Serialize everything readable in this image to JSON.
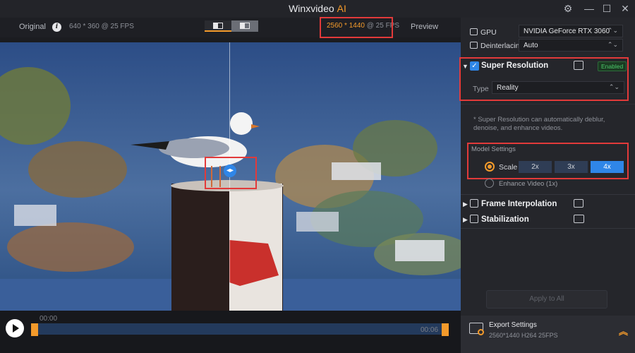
{
  "app": {
    "title": "Winxvideo",
    "title_ai": "AI"
  },
  "compare": {
    "original_label": "Original",
    "original_res": "640 * 360 @ 25 FPS",
    "output_res": "2560 * 1440",
    "output_fps": "@ 25 FPS",
    "preview_label": "Preview"
  },
  "timeline": {
    "start": "00:00",
    "end": "00:06"
  },
  "settings": {
    "gpu_label": "GPU",
    "gpu_value": "NVIDIA GeForce RTX 3060",
    "deinterlacing_label": "Deinterlacing",
    "deinterlacing_value": "Auto",
    "super_resolution": {
      "title": "Super Resolution",
      "status": "Enabled",
      "type_label": "Type",
      "type_value": "Reality",
      "hint": "* Super Resolution can automatically deblur, denoise, and enhance videos.",
      "model_settings_label": "Model Settings",
      "scale_label": "Scale",
      "scales": [
        "2x",
        "3x",
        "4x"
      ],
      "active_scale": "4x",
      "enhance_label": "Enhance Video (1x)"
    },
    "frame_interpolation_title": "Frame Interpolation",
    "stabilization_title": "Stabilization",
    "apply_all_label": "Apply to All"
  },
  "export": {
    "title": "Export Settings",
    "details": "2560*1440  H264  25FPS"
  },
  "colors": {
    "accent": "#f39a2b",
    "blue": "#2f86e8",
    "highlight": "#e23a3a",
    "enabled": "#4bc86a"
  }
}
